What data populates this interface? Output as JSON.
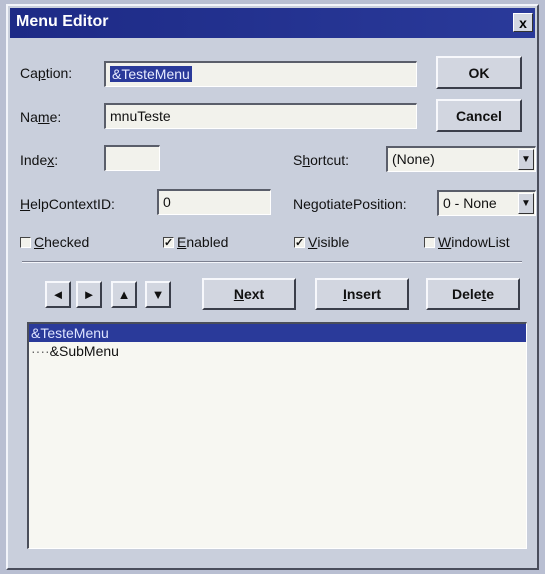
{
  "window": {
    "title": "Menu Editor",
    "close_label": "x"
  },
  "caption": {
    "label_pre": "Ca",
    "label_key": "p",
    "label_post": "tion:",
    "value": "&TesteMenu"
  },
  "name": {
    "label_pre": "Na",
    "label_key": "m",
    "label_post": "e:",
    "value": "mnuTeste"
  },
  "index": {
    "label_pre": "Inde",
    "label_key": "x",
    "label_post": ":",
    "value": ""
  },
  "shortcut": {
    "label_pre": "S",
    "label_key": "h",
    "label_post": "ortcut:",
    "value": "(None)"
  },
  "helpcontext": {
    "label_pre": "",
    "label_key": "H",
    "label_post": "elpContextID:",
    "value": "0"
  },
  "negotiate": {
    "label_pre": "Ne",
    "label_key": "g",
    "label_post": "otiatePosition:",
    "value": "0 - None"
  },
  "checks": {
    "checked": {
      "key": "C",
      "rest": "hecked",
      "state": false
    },
    "enabled": {
      "key": "E",
      "rest": "nabled",
      "state": true
    },
    "visible": {
      "key": "V",
      "rest": "isible",
      "state": true
    },
    "windowlist": {
      "key": "W",
      "rest": "indowList",
      "state": false
    }
  },
  "buttons": {
    "ok": "OK",
    "cancel": "Cancel",
    "next_key": "N",
    "next_rest": "ext",
    "insert_key": "I",
    "insert_rest": "nsert",
    "delete_pre": "Dele",
    "delete_key": "t",
    "delete_post": "e",
    "left": "◄",
    "right": "►",
    "up": "▲",
    "down": "▼"
  },
  "menu_items": [
    {
      "label": "&TesteMenu",
      "selected": true
    },
    {
      "prefix": "····",
      "label": "&SubMenu",
      "selected": false
    }
  ],
  "colors": {
    "title_bar": "#1d2a86",
    "selection": "#2a3a9a",
    "dialog": "#c9cfdc"
  }
}
